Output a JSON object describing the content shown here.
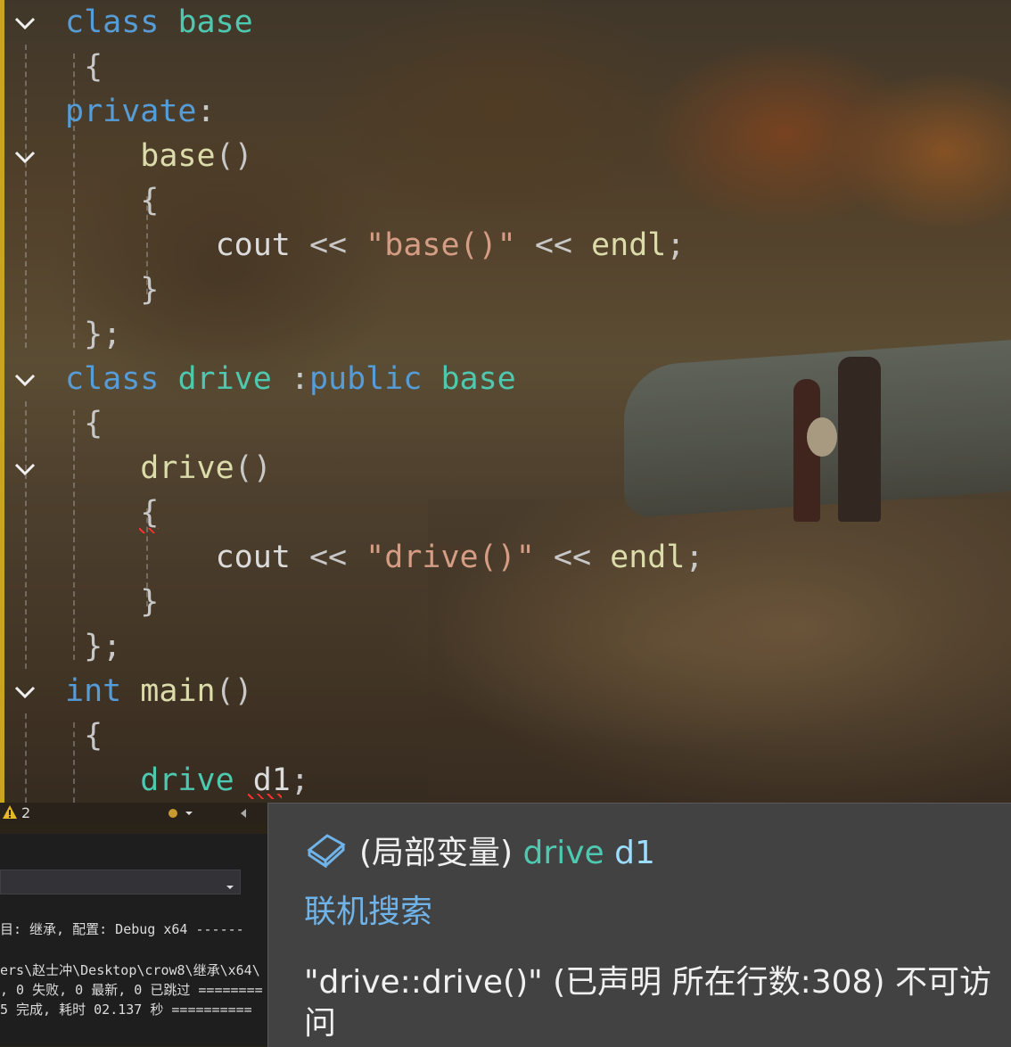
{
  "editor": {
    "lines": [
      [
        {
          "t": "class",
          "c": "kw"
        },
        {
          "t": " ",
          "c": "pl"
        },
        {
          "t": "base",
          "c": "ty"
        }
      ],
      [
        {
          "t": " {",
          "c": "pu"
        }
      ],
      [
        {
          "t": "private",
          "c": "kw"
        },
        {
          "t": ":",
          "c": "pu"
        }
      ],
      [
        {
          "t": "    base",
          "c": "fn"
        },
        {
          "t": "()",
          "c": "pu"
        }
      ],
      [
        {
          "t": "    {",
          "c": "pu"
        }
      ],
      [
        {
          "t": "        cout",
          "c": "pl"
        },
        {
          "t": " << ",
          "c": "pu"
        },
        {
          "t": "\"base()\"",
          "c": "st"
        },
        {
          "t": " << ",
          "c": "pu"
        },
        {
          "t": "endl",
          "c": "fn"
        },
        {
          "t": ";",
          "c": "pu"
        }
      ],
      [
        {
          "t": "    }",
          "c": "pu"
        }
      ],
      [
        {
          "t": " };",
          "c": "pu"
        }
      ],
      [
        {
          "t": "class",
          "c": "kw"
        },
        {
          "t": " ",
          "c": "pl"
        },
        {
          "t": "drive",
          "c": "ty"
        },
        {
          "t": " :",
          "c": "pu"
        },
        {
          "t": "public",
          "c": "kw"
        },
        {
          "t": " ",
          "c": "pl"
        },
        {
          "t": "base",
          "c": "ty"
        }
      ],
      [
        {
          "t": " {",
          "c": "pu"
        }
      ],
      [
        {
          "t": "    drive",
          "c": "fn"
        },
        {
          "t": "()",
          "c": "pu"
        }
      ],
      [
        {
          "t": "    {",
          "c": "pu"
        }
      ],
      [
        {
          "t": "        cout",
          "c": "pl"
        },
        {
          "t": " << ",
          "c": "pu"
        },
        {
          "t": "\"drive()\"",
          "c": "st"
        },
        {
          "t": " << ",
          "c": "pu"
        },
        {
          "t": "endl",
          "c": "fn"
        },
        {
          "t": ";",
          "c": "pu"
        }
      ],
      [
        {
          "t": "    }",
          "c": "pu"
        }
      ],
      [
        {
          "t": " };",
          "c": "pu"
        }
      ],
      [
        {
          "t": "int",
          "c": "kw"
        },
        {
          "t": " ",
          "c": "pl"
        },
        {
          "t": "main",
          "c": "fn"
        },
        {
          "t": "()",
          "c": "pu"
        }
      ],
      [
        {
          "t": " {",
          "c": "pu"
        }
      ],
      [
        {
          "t": "    drive",
          "c": "ty"
        },
        {
          "t": " ",
          "c": "pl"
        },
        {
          "t": "d1",
          "c": "pl"
        },
        {
          "t": ";",
          "c": "pu"
        }
      ]
    ]
  },
  "status": {
    "warning_count": "2"
  },
  "output": {
    "lines": [
      "目: 继承, 配置: Debug x64 ------",
      "ers\\赵士冲\\Desktop\\crow8\\继承\\x64\\",
      ", 0 失败, 0 最新, 0 已跳过 ========",
      "5 完成, 耗时 02.137 秒 =========="
    ]
  },
  "tooltip": {
    "kind": "(局部变量) ",
    "type": "drive",
    "name": " d1",
    "online_search": "联机搜索",
    "error": "\"drive::drive()\" (已声明 所在行数:308) 不可访问"
  },
  "colors": {
    "keyword": "#569cd6",
    "type": "#4ec9b0",
    "function": "#dcdcaa",
    "string": "#d69d85",
    "link": "#6fb3e8"
  },
  "icons": [
    "chevron-down-icon",
    "warning-icon",
    "local-variable-icon",
    "dropdown-arrow-icon"
  ]
}
